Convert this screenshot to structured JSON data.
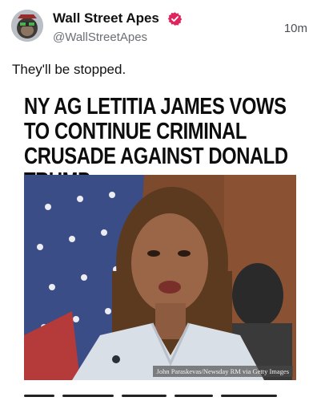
{
  "post": {
    "author": {
      "display_name": "Wall Street Apes",
      "handle": "@WallStreetApes",
      "verified_icon": "verified-badge-icon",
      "verified_color": "#e0245e",
      "avatar_icon": "ape-avatar-icon"
    },
    "timestamp": "10m",
    "text": "They'll be stopped.",
    "media": {
      "headline": "NY AG LETITIA JAMES VOWS TO CONTINUE CRIMINAL CRUSADE AGAINST DONALD TRUMP",
      "photo_credit": "John Paraskevas/Newsday RM via Getty Images"
    }
  }
}
